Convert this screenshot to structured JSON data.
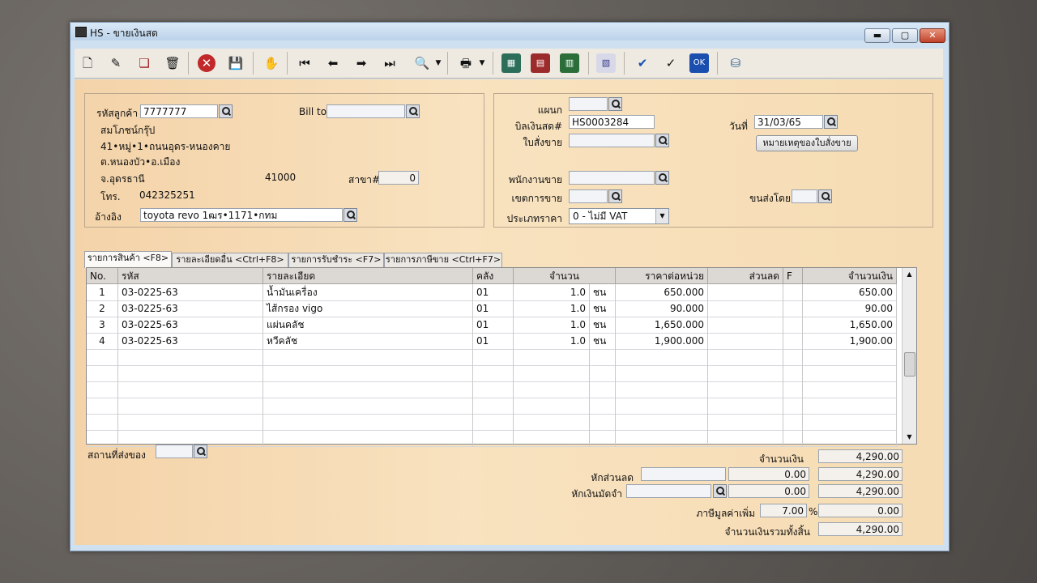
{
  "window": {
    "title": "HS - ขายเงินสด"
  },
  "toolbar": {
    "icons": [
      "new-doc-icon",
      "edit-doc-icon",
      "copy-doc-icon",
      "delete-icon",
      "cancel-icon",
      "save-icon",
      "handshake-icon",
      "first-record-icon",
      "prev-record-icon",
      "next-record-icon",
      "last-record-icon",
      "search-doc-icon",
      "print-icon",
      "calc-icon",
      "doc-list-icon",
      "chart-icon",
      "report-icon",
      "approve-icon",
      "check-icon",
      "ok-icon",
      "export-icon"
    ]
  },
  "customer": {
    "code_label": "รหัสลูกค้า",
    "code": "7777777",
    "name": "สมโภชน์กรุ๊ป",
    "addr1": "41•หมู่•1•ถนนอุดร-หนองคาย",
    "addr2": "ต.หนองบัว•อ.เมือง",
    "addr3": "จ.อุดรธานี",
    "zip": "41000",
    "branch_label": "สาขา#",
    "branch": "0",
    "phone_label": "โทร.",
    "phone": "042325251",
    "ref_label": "อ้างอิง",
    "ref": "toyota revo 1ฒร•1171•กทม",
    "billto_label": "Bill to",
    "billto": ""
  },
  "bill": {
    "dept_label": "แผนก",
    "dept": "",
    "cashbill_label": "บิลเงินสด#",
    "cashbill": "HS0003284",
    "order_label": "ใบสั่งขาย",
    "order": "",
    "date_label": "วันที่",
    "date": "31/03/65",
    "note_button": "หมายเหตุของใบสั่งขาย",
    "salesman_label": "พนักงานขาย",
    "salesman": "",
    "area_label": "เขตการขาย",
    "area": "",
    "ship_by_label": "ขนส่งโดย",
    "ship_by": "",
    "price_type_label": "ประเภทราคา",
    "price_type": "0 - ไม่มี VAT"
  },
  "tabs": [
    "รายการสินค้า <F8>",
    "รายละเอียดอื่น <Ctrl+F8>",
    "รายการรับชำระ <F7>",
    "รายการภาษีขาย <Ctrl+F7>"
  ],
  "grid": {
    "headers": [
      "No.",
      "รหัส",
      "รายละเอียด",
      "คลัง",
      "จำนวน",
      "ราคาต่อหน่วย",
      "ส่วนลด",
      "F",
      "จำนวนเงิน"
    ],
    "rows": [
      {
        "no": "1",
        "code": "03-0225-63",
        "desc": "น้ำมันเครื่อง",
        "wh": "01",
        "qty": "1.0",
        "unit": "ชน",
        "price": "650.000",
        "disc": "",
        "f": "",
        "amount": "650.00"
      },
      {
        "no": "2",
        "code": "03-0225-63",
        "desc": "ไส้กรอง vigo",
        "wh": "01",
        "qty": "1.0",
        "unit": "ชน",
        "price": "90.000",
        "disc": "",
        "f": "",
        "amount": "90.00"
      },
      {
        "no": "3",
        "code": "03-0225-63",
        "desc": "แผ่นคลัช",
        "wh": "01",
        "qty": "1.0",
        "unit": "ชน",
        "price": "1,650.000",
        "disc": "",
        "f": "",
        "amount": "1,650.00"
      },
      {
        "no": "4",
        "code": "03-0225-63",
        "desc": "หวีคลัช",
        "wh": "01",
        "qty": "1.0",
        "unit": "ชน",
        "price": "1,900.000",
        "disc": "",
        "f": "",
        "amount": "1,900.00"
      }
    ]
  },
  "footer": {
    "ship_place_label": "สถานที่ส่งของ",
    "ship_place": "",
    "amount_label": "จำนวนเงิน",
    "amount": "4,290.00",
    "discount_label": "หักส่วนลด",
    "discount_text": "",
    "discount_value": "0.00",
    "after_discount": "4,290.00",
    "deposit_label": "หักเงินมัดจำ",
    "deposit_text": "",
    "deposit_value": "0.00",
    "after_deposit": "4,290.00",
    "vat_label": "ภาษีมูลค่าเพิ่ม",
    "vat_rate": "7.00",
    "vat_pct": "%",
    "vat_value": "0.00",
    "total_label": "จำนวนเงินรวมทั้งสิ้น",
    "total": "4,290.00"
  }
}
